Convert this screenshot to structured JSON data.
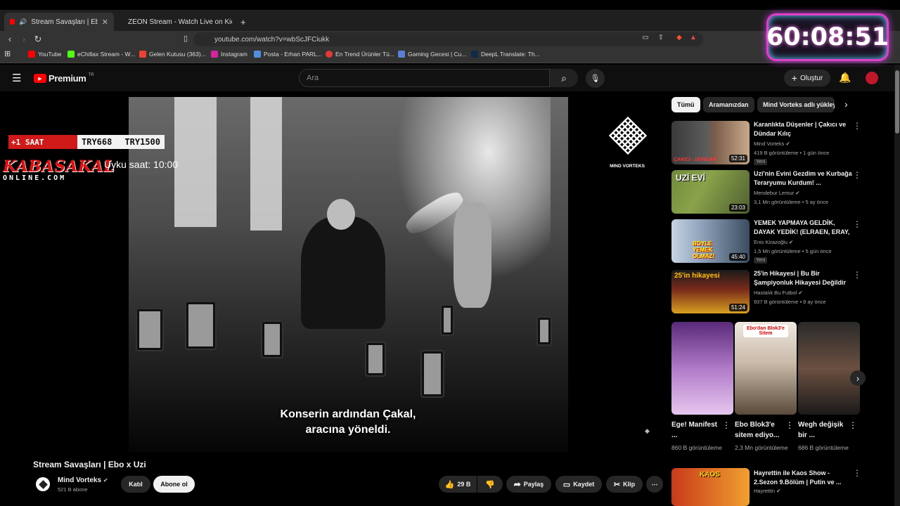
{
  "browser": {
    "tabs": [
      {
        "title": "Stream Savaşları | Ebo x Uzi -",
        "active": true
      },
      {
        "title": "ZEON Stream - Watch Live on Kick",
        "active": false
      }
    ],
    "new_tab": "+",
    "url": "youtube.com/watch?v=wbScJFCiukk",
    "bookmarks": [
      "YouTube",
      "eChillax Stream - W...",
      "Gelen Kutusu (363)...",
      "Instagram",
      "Posta - Erhan PARL...",
      "En Trend Ürünler Tü...",
      "Gaming Gecesi | Cu...",
      "DeepL Translate: Th..."
    ]
  },
  "youtube": {
    "logo": "Premium",
    "logo_sup": "TR",
    "search_placeholder": "Ara",
    "create_label": "Oluştur",
    "filter_chips": [
      "Tümü",
      "Aramanızdan",
      "Mind Vorteks adlı yükley"
    ]
  },
  "video": {
    "subtitle_line1": "Konserin ardından Çakal,",
    "subtitle_line2": "aracına yöneldi.",
    "watermark": "MIND VORTEKS",
    "title": "Stream Savaşları | Ebo x Uzi",
    "channel": "Mind Vorteks",
    "subscribers": "521 B abone",
    "join_label": "Katıl",
    "subscribe_label": "Abone ol",
    "likes": "29 B",
    "share_label": "Paylaş",
    "save_label": "Kaydet",
    "clip_label": "Klip"
  },
  "stream_overlay": {
    "bar_left": "+1 SAAT",
    "bar_mid": "TRY668",
    "bar_right": "TRY1500",
    "brand_top": "KABASAKAL",
    "brand_bottom": "ONLINE.COM",
    "sleep_text": "Uyku saat: 10:00",
    "timer": "60:08:51"
  },
  "recommendations": [
    {
      "title": "Karanlıkta Düşenler | Çakıcı ve Dündar Kılıç",
      "channel": "Mind Vorteks",
      "meta": "419 B görüntüleme • 1 gün önce",
      "duration": "52:31",
      "badge": "Yeni",
      "thumb_caption": "ÇAKICI - DÜNDAR"
    },
    {
      "title": "Uzi'nin Evini Gezdim ve Kurbağa Teraryumu Kurdum! ...",
      "channel": "Mendebur Lemur",
      "meta": "3,1 Mn görüntüleme • 5 ay önce",
      "duration": "23:03",
      "badge": "",
      "thumb_caption": "UZİ EVİ"
    },
    {
      "title": "YEMEK YAPMAYA GELDİK, DAYAK YEDİK! (ELRAEN, ERAY, ...",
      "channel": "Enis Kirazoğlu",
      "meta": "1,5 Mn görüntüleme • 5 gün önce",
      "duration": "45:40",
      "badge": "Yeni",
      "thumb_caption": "BÖYLE YEMEK OLMAZ!"
    },
    {
      "title": "25'in Hikayesi | Bu Bir Şampiyonluk Hikayesi Değildir",
      "channel": "Hastalık Bu Futbol",
      "meta": "937 B görüntüleme • 9 ay önce",
      "duration": "51:24",
      "badge": "",
      "thumb_caption": "25'in hikayesi"
    }
  ],
  "shorts": [
    {
      "title": "Ege! Manifest ...",
      "views": "860 B görüntüleme"
    },
    {
      "title": "Ebo Blok3'e sitem ediyo...",
      "views": "2,3 Mn görüntüleme",
      "thumb_caption": "Ebo'dan Blok3'e Sitem"
    },
    {
      "title": "Wegh değişik bir ...",
      "views": "686 B görüntüleme"
    }
  ],
  "next_rec": {
    "title": "Hayrettin ile Kaos Show - 2.Sezon 9.Bölüm | Putin ve ...",
    "channel": "Hayrettin",
    "thumb_caption": "KAOS"
  }
}
